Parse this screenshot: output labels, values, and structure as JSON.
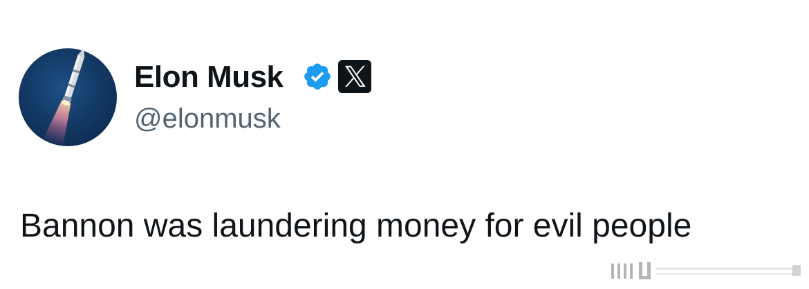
{
  "tweet": {
    "author": {
      "display_name": "Elon Musk",
      "handle": "@elonmusk",
      "verified": true,
      "affiliation_badge": "x-logo-icon",
      "avatar_icon": "rocket-avatar-icon"
    },
    "text": "Bannon was laundering money for evil people"
  },
  "colors": {
    "text_primary": "#0f1419",
    "text_secondary": "#536471",
    "verified_blue": "#1d9bf0",
    "avatar_bg": "#133a66",
    "x_badge_bg": "#0f1419"
  }
}
